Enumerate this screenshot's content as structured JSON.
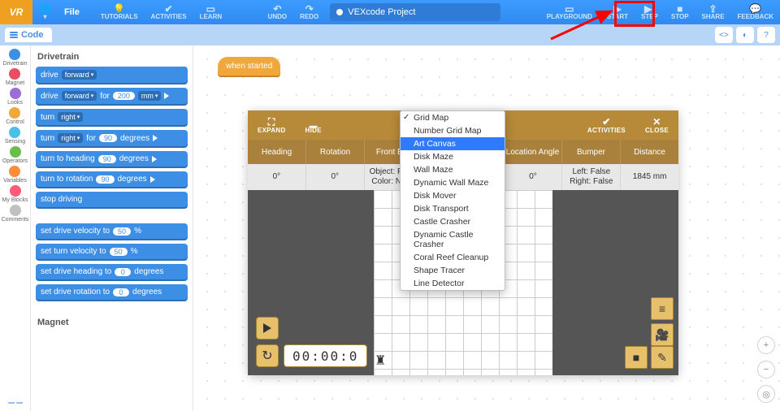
{
  "topbar": {
    "logo": "VR",
    "file": "File",
    "tutorials": "TUTORIALS",
    "activities": "ACTIVITIES",
    "learn": "LEARN",
    "undo": "UNDO",
    "redo": "REDO",
    "project_name": "VEXcode Project",
    "playground": "PLAYGROUND",
    "start": "START",
    "step": "STEP",
    "stop": "STOP",
    "share": "SHARE",
    "feedback": "FEEDBACK"
  },
  "secbar": {
    "code": "Code"
  },
  "categories": [
    {
      "label": "Drivetrain",
      "color": "#3d8fe6"
    },
    {
      "label": "Magnet",
      "color": "#e94e62"
    },
    {
      "label": "Looks",
      "color": "#9a6dd7"
    },
    {
      "label": "Control",
      "color": "#f0a83c"
    },
    {
      "label": "Sensing",
      "color": "#4cbfe6"
    },
    {
      "label": "Operators",
      "color": "#6abf4b"
    },
    {
      "label": "Variables",
      "color": "#ff8c3b"
    },
    {
      "label": "My Blocks",
      "color": "#ff5a7a"
    },
    {
      "label": "Comments",
      "color": "#c0c0c0"
    }
  ],
  "palette": {
    "header1": "Drivetrain",
    "labels": {
      "drive": "drive",
      "forward": "forward",
      "for": "for",
      "mm": "mm",
      "turn": "turn",
      "right": "right",
      "degrees": "degrees",
      "turn_to_heading": "turn to heading",
      "turn_to_rotation": "turn to rotation",
      "stop_driving": "stop driving",
      "set_drive_velocity": "set drive velocity to",
      "percent": "%",
      "set_turn_velocity": "set turn velocity to",
      "set_drive_heading": "set drive heading to",
      "set_drive_rotation": "set drive rotation to"
    },
    "vals": {
      "dist": "200",
      "deg90": "90",
      "deg0": "0",
      "vel50": "50"
    },
    "header2": "Magnet"
  },
  "hat": "when started",
  "playground": {
    "expand": "EXPAND",
    "hide": "HIDE",
    "activities": "ACTIVITIES",
    "close": "CLOSE",
    "headers": [
      "Heading",
      "Rotation",
      "Front Eye",
      "",
      "",
      "Location Angle",
      "Bumper",
      "Distance"
    ],
    "values": {
      "heading": "0°",
      "rotation": "0°",
      "eye1": "Object: False",
      "eye2": "Color: None",
      "loc": "0°",
      "bumper1": "Left: False",
      "bumper2": "Right: False",
      "distance": "1845 mm"
    },
    "timer": "00:00:0"
  },
  "menu": [
    {
      "label": "Grid Map",
      "checked": true,
      "selected": false
    },
    {
      "label": "Number Grid Map",
      "checked": false,
      "selected": false
    },
    {
      "label": "Art Canvas",
      "checked": false,
      "selected": true
    },
    {
      "label": "Disk Maze",
      "checked": false,
      "selected": false
    },
    {
      "label": "Wall Maze",
      "checked": false,
      "selected": false
    },
    {
      "label": "Dynamic Wall Maze",
      "checked": false,
      "selected": false
    },
    {
      "label": "Disk Mover",
      "checked": false,
      "selected": false
    },
    {
      "label": "Disk Transport",
      "checked": false,
      "selected": false
    },
    {
      "label": "Castle Crasher",
      "checked": false,
      "selected": false
    },
    {
      "label": "Dynamic Castle Crasher",
      "checked": false,
      "selected": false
    },
    {
      "label": "Coral Reef Cleanup",
      "checked": false,
      "selected": false
    },
    {
      "label": "Shape Tracer",
      "checked": false,
      "selected": false
    },
    {
      "label": "Line Detector",
      "checked": false,
      "selected": false
    }
  ]
}
